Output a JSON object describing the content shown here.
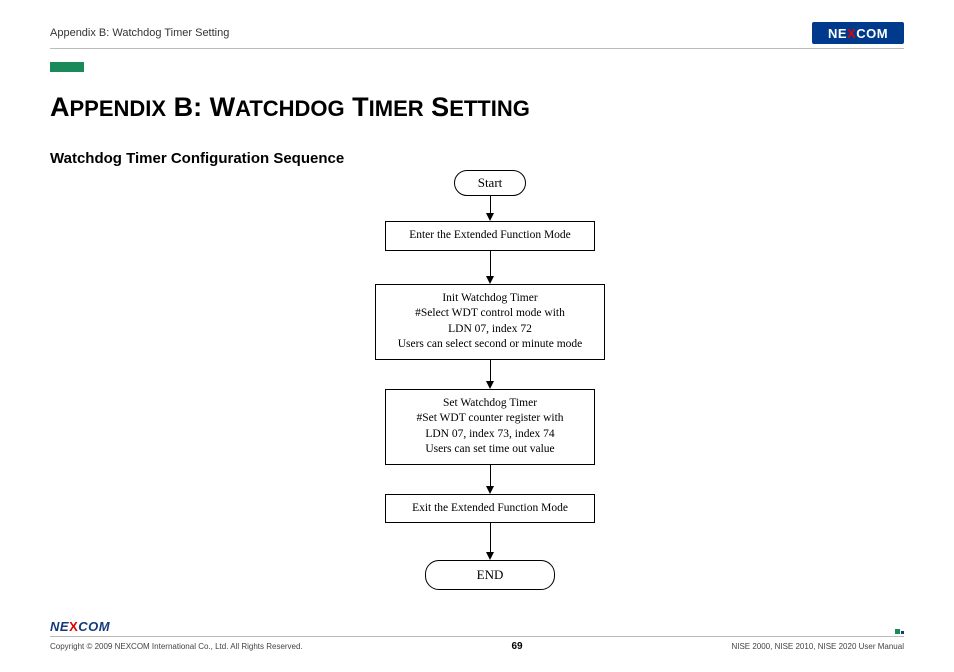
{
  "header": {
    "breadcrumb": "Appendix B: Watchdog Timer Setting",
    "logo_text_pre": "NE",
    "logo_text_x": "X",
    "logo_text_post": "COM"
  },
  "content": {
    "title": "Appendix B: Watchdog Timer Setting",
    "section_title": "Watchdog Timer Configuration Sequence",
    "flowchart": {
      "start": "Start",
      "step1": "Enter the Extended Function Mode",
      "step2_line1": "Init Watchdog Timer",
      "step2_line2": "#Select WDT control mode with",
      "step2_line3": "LDN 07, index 72",
      "step2_line4": "Users can select second or minute mode",
      "step3_line1": "Set Watchdog Timer",
      "step3_line2": "#Set WDT counter register with",
      "step3_line3": "LDN 07, index 73, index 74",
      "step3_line4": "Users can set time out value",
      "step4": "Exit the Extended Function Mode",
      "end": "END"
    }
  },
  "footer": {
    "logo_text_pre": "NE",
    "logo_text_x": "X",
    "logo_text_post": "COM",
    "copyright": "Copyright © 2009 NEXCOM International Co., Ltd. All Rights Reserved.",
    "page": "69",
    "manual": "NISE 2000, NISE 2010, NISE 2020 User Manual"
  }
}
